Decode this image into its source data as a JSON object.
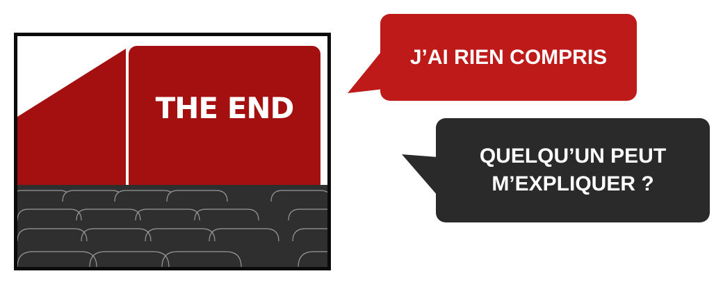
{
  "screen": {
    "text": "THE END"
  },
  "bubbles": {
    "first": "J’AI RIEN COMPRIS",
    "second_line1": "QUELQU’UN PEUT",
    "second_line2": "M’EXPLIQUER ?"
  },
  "colors": {
    "screen_red": "#a40f0f",
    "bubble_red": "#be1a1a",
    "bubble_dark": "#2a2a2a",
    "seats": "#2f2f2f",
    "frame": "#0b0b0b"
  },
  "icons": {
    "seats": "cinema-seats-icon",
    "screen": "cinema-screen-icon"
  }
}
